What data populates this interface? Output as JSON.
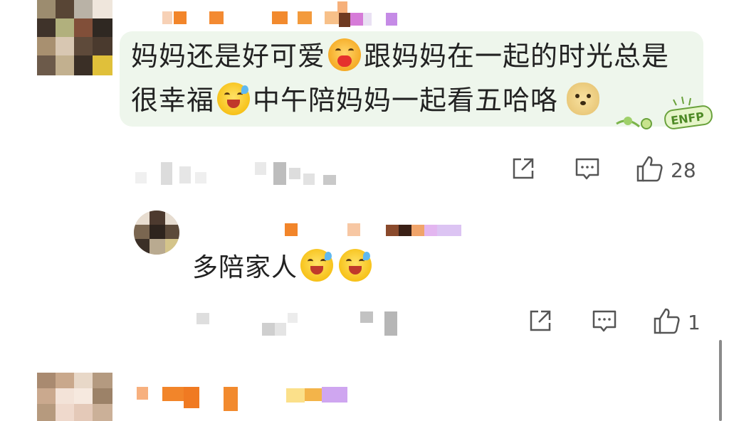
{
  "comments": [
    {
      "text_line1_a": "妈妈还是好可爱",
      "text_line1_b": "跟妈妈在一起的时光总是",
      "text_line2_a": "很幸福",
      "text_line2_b": "中午陪妈妈一起看五哈咯",
      "sticker_label": "ENFP",
      "likes": "28"
    },
    {
      "text": "多陪家人",
      "likes": "1"
    }
  ],
  "icons": {
    "share": "share-icon",
    "comment": "comment-icon",
    "like": "thumbs-up-icon"
  },
  "colors": {
    "bubble": "#eef6ec",
    "text": "#222222",
    "icon": "#555555"
  }
}
